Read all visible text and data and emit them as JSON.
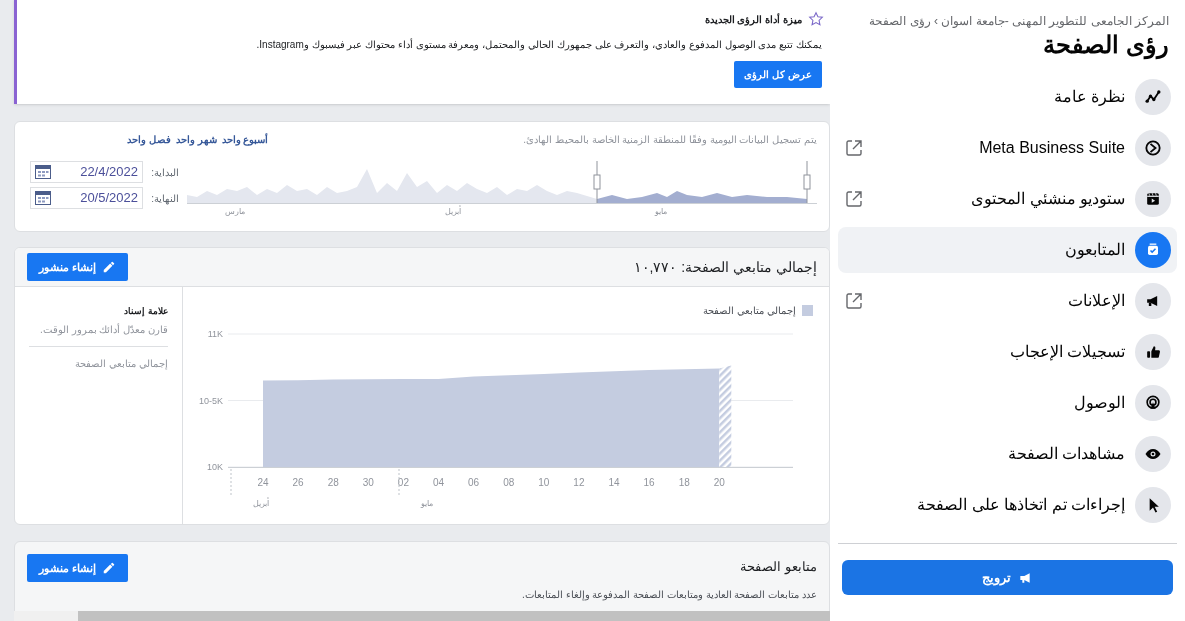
{
  "feature_card": {
    "title": "ميزة أداة الرؤى الجديدة",
    "text": "يمكنك تتبع مدى الوصول المدفوع والعادي، والتعرف على جمهورك الحالي والمحتمل، ومعرفة مستوى أداء محتواك عبر فيسبوك وInstagram.",
    "button": "عرض كل الرؤى"
  },
  "date_card": {
    "note": "يتم تسجيل البيانات اليومية وفقًا للمنطقة الزمنية الخاصة بالمحيط الهادئ.",
    "ranges": [
      {
        "label": "أسبوع واحد",
        "selected": false
      },
      {
        "label": "شهر واحد",
        "selected": false
      },
      {
        "label": "فصل واحد",
        "selected": false
      }
    ],
    "start": {
      "label": "البداية:",
      "value": "22/4/2022"
    },
    "end": {
      "label": "النهاية:",
      "value": "20/5/2022"
    },
    "timeline_months": [
      "مايو",
      "أبريل",
      "مارس"
    ]
  },
  "followers_card": {
    "title": "إجمالي متابعي الصفحة: ١٠,٧٧٠",
    "button": "إنشاء منشور",
    "benchmark": {
      "title": "علامة إسناد",
      "text": "قارن معدّل أدائك بمرور الوقت.",
      "item": "إجمالي متابعي الصفحة"
    },
    "chart_data": {
      "type": "area",
      "categories": [
        "24",
        "26",
        "28",
        "30",
        "02",
        "04",
        "06",
        "08",
        "10",
        "12",
        "14",
        "16",
        "18",
        "20"
      ],
      "series": [
        {
          "name": "إجمالي متابعي الصفحة",
          "color": "#c4cce0",
          "values": [
            10650,
            10652,
            10657,
            10660,
            10662,
            10662,
            10680,
            10690,
            10700,
            10710,
            10720,
            10730,
            10735,
            10740
          ]
        }
      ],
      "ylim": [
        10000,
        11000
      ],
      "yticks": [
        {
          "value": 10000,
          "label": "10K"
        },
        {
          "value": 10500,
          "label": "10-5K"
        },
        {
          "value": 11000,
          "label": "11K"
        }
      ]
    },
    "month_labels": [
      "مايو",
      "أبريل"
    ]
  },
  "page_followers_card": {
    "title": "متابعو الصفحة",
    "text": "عدد متابعات الصفحة العادية ومتابعات الصفحة المدفوعة وإلغاء المتابعات.",
    "button": "إنشاء منشور"
  },
  "sidebar": {
    "breadcrumb": "المركز الجامعى للتطوير المهنى -جامعة اسوان › رؤى الصفحة",
    "title": "رؤى الصفحة",
    "items": [
      {
        "kind": "overview",
        "label": "نظرة عامة",
        "external": false,
        "selected": false
      },
      {
        "kind": "suite",
        "label": "Meta Business Suite",
        "external": true,
        "selected": false
      },
      {
        "kind": "studio",
        "label": "ستوديو منشئي المحتوى",
        "external": true,
        "selected": false
      },
      {
        "kind": "followers",
        "label": "المتابعون",
        "external": false,
        "selected": true
      },
      {
        "kind": "ads",
        "label": "الإعلانات",
        "external": true,
        "selected": false
      },
      {
        "kind": "likes",
        "label": "تسجيلات الإعجاب",
        "external": false,
        "selected": false
      },
      {
        "kind": "reach",
        "label": "الوصول",
        "external": false,
        "selected": false
      },
      {
        "kind": "views",
        "label": "مشاهدات الصفحة",
        "external": false,
        "selected": false
      },
      {
        "kind": "actions",
        "label": "إجراءات تم اتخاذها على الصفحة",
        "external": false,
        "selected": false
      }
    ],
    "promote_button": "ترويج"
  }
}
